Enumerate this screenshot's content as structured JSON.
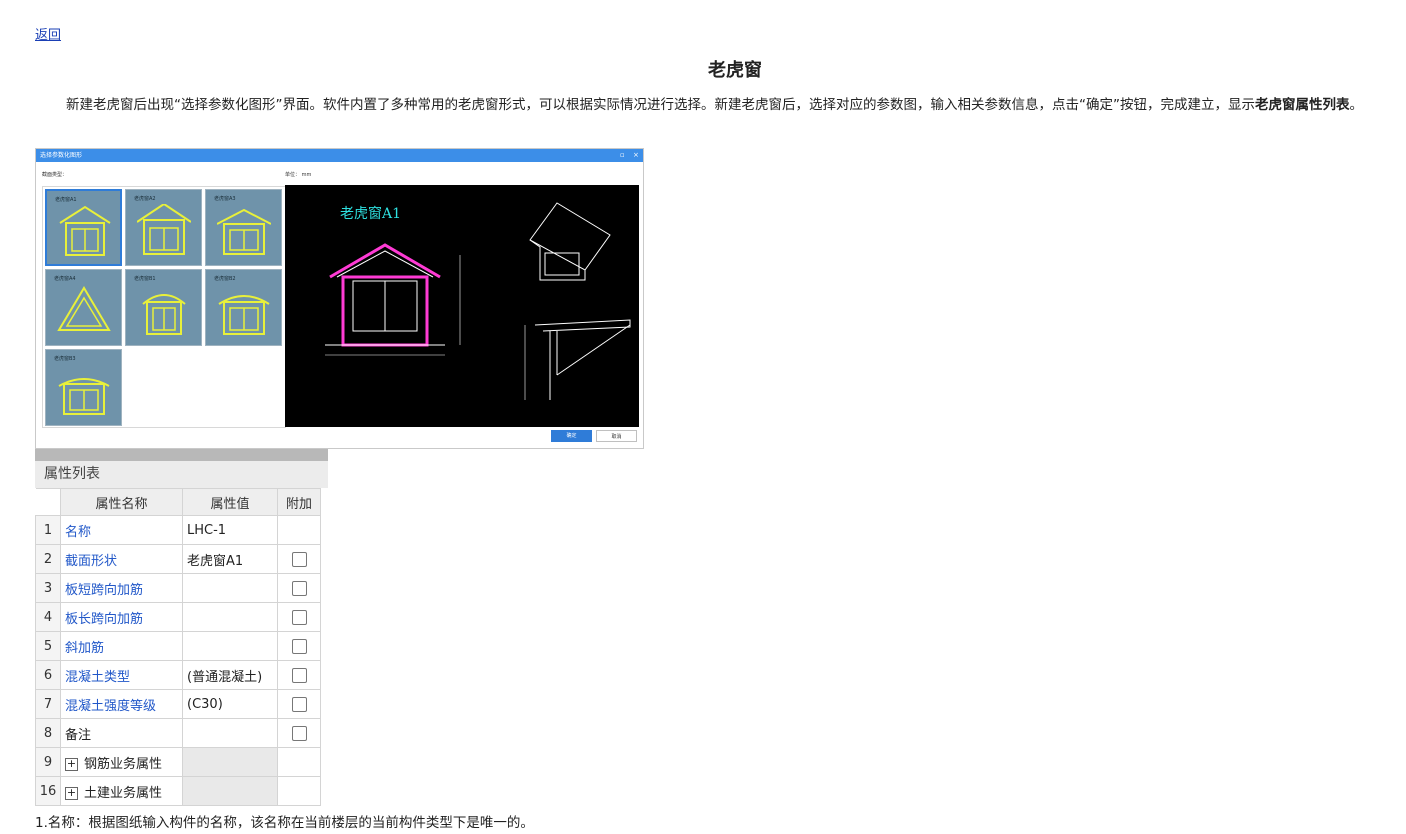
{
  "nav": {
    "back": "返回"
  },
  "page": {
    "title": "老虎窗",
    "para_main": "新建老虎窗后出现“选择参数化图形”界面。软件内置了多种常用的老虎窗形式，可以根据实际情况进行选择。新建老虎窗后，选择对应的参数图，输入相关参数信息，点击“确定”按钮，完成建立，显示",
    "para_bold": "老虎窗属性列表",
    "para_end": "。"
  },
  "dialog": {
    "title": "选择参数化图形",
    "section_label": "截面类型：",
    "unit_label": "单位：  mm",
    "shapes": [
      {
        "name": "老虎窗A1",
        "icon": "gable-window",
        "selected": true
      },
      {
        "name": "老虎窗A2",
        "icon": "gable-window-wide"
      },
      {
        "name": "老虎窗A3",
        "icon": "gable-window-flat"
      },
      {
        "name": "老虎窗A4",
        "icon": "triangle-window"
      },
      {
        "name": "老虎窗B1",
        "icon": "arched-window"
      },
      {
        "name": "老虎窗B2",
        "icon": "arched-window-wide"
      },
      {
        "name": "老虎窗B3",
        "icon": "arched-window-low"
      }
    ],
    "preview_title": "老虎窗A1",
    "ok": "确定",
    "cancel": "取消",
    "accent": "#2f7cd8"
  },
  "property_list": {
    "title": "属性列表",
    "columns": [
      "属性名称",
      "属性值",
      "附加"
    ],
    "rows": [
      {
        "n": "1",
        "name": "名称",
        "value": "LHC-1",
        "check": false,
        "link": true
      },
      {
        "n": "2",
        "name": "截面形状",
        "value": "老虎窗A1",
        "check": true,
        "link": true
      },
      {
        "n": "3",
        "name": "板短跨向加筋",
        "value": "",
        "check": true,
        "link": true
      },
      {
        "n": "4",
        "name": "板长跨向加筋",
        "value": "",
        "check": true,
        "link": true
      },
      {
        "n": "5",
        "name": "斜加筋",
        "value": "",
        "check": true,
        "link": true
      },
      {
        "n": "6",
        "name": "混凝土类型",
        "value": "(普通混凝土)",
        "check": true,
        "link": true
      },
      {
        "n": "7",
        "name": "混凝土强度等级",
        "value": "(C30)",
        "check": true,
        "link": true
      },
      {
        "n": "8",
        "name": "备注",
        "value": "",
        "check": true,
        "link": false
      },
      {
        "n": "9",
        "name": "钢筋业务属性",
        "value": "",
        "check": false,
        "group": true
      },
      {
        "n": "16",
        "name": "土建业务属性",
        "value": "",
        "check": false,
        "group": true
      }
    ]
  },
  "footnote": "1.名称：根据图纸输入构件的名称，该名称在当前楼层的当前构件类型下是唯一的。"
}
